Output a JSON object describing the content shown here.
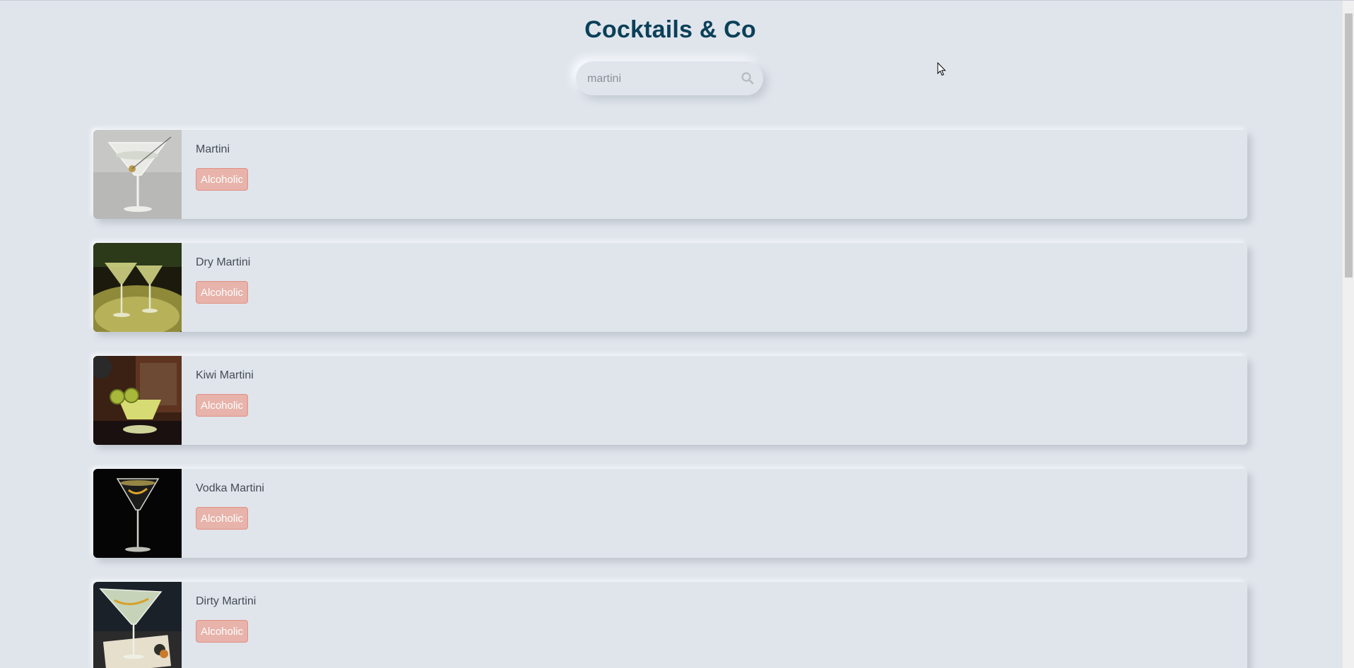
{
  "header": {
    "title": "Cocktails & Co"
  },
  "search": {
    "value": "martini",
    "icon": "search-icon"
  },
  "cocktails": [
    {
      "name": "Martini",
      "category": "Alcoholic"
    },
    {
      "name": "Dry Martini",
      "category": "Alcoholic"
    },
    {
      "name": "Kiwi Martini",
      "category": "Alcoholic"
    },
    {
      "name": "Vodka Martini",
      "category": "Alcoholic"
    },
    {
      "name": "Dirty Martini",
      "category": "Alcoholic"
    }
  ],
  "colors": {
    "background": "#e0e5ec",
    "title": "#0b4058",
    "badge_bg": "#e7b3aa",
    "badge_border": "#e19082"
  }
}
